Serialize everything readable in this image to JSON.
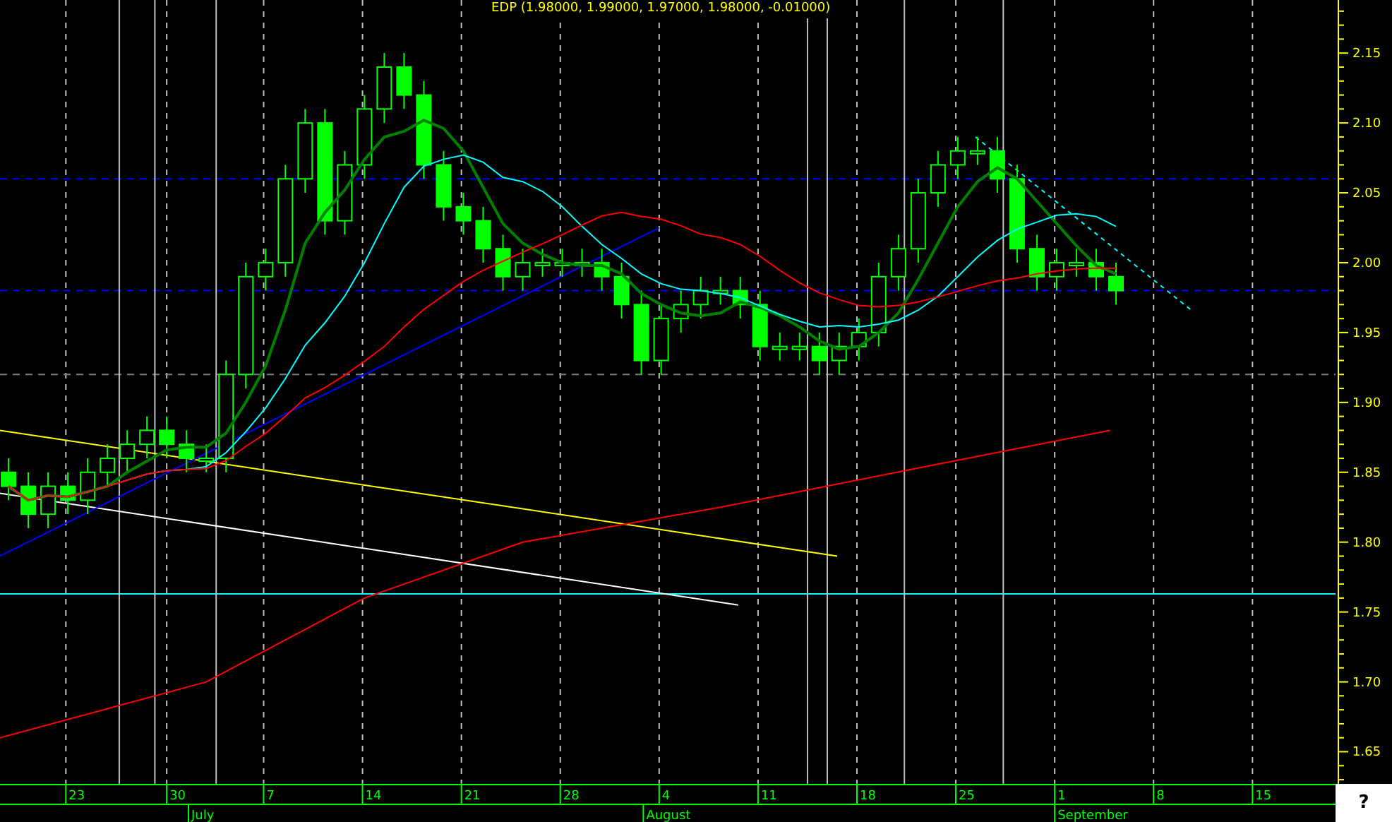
{
  "title": "EDP (1.98000, 1.99000, 1.97000, 1.98000, -0.01000)",
  "y_axis_labels": [
    "2.15",
    "2.10",
    "2.05",
    "2.00",
    "1.95",
    "1.90",
    "1.85",
    "1.80",
    "1.75",
    "1.70",
    "1.65"
  ],
  "x_axis_day_labels": [
    "23",
    "30",
    "7",
    "14",
    "21",
    "28",
    "4",
    "11",
    "18",
    "25",
    "1",
    "8",
    "15"
  ],
  "month_labels": [
    "July",
    "August",
    "September"
  ],
  "help_label": "?"
}
